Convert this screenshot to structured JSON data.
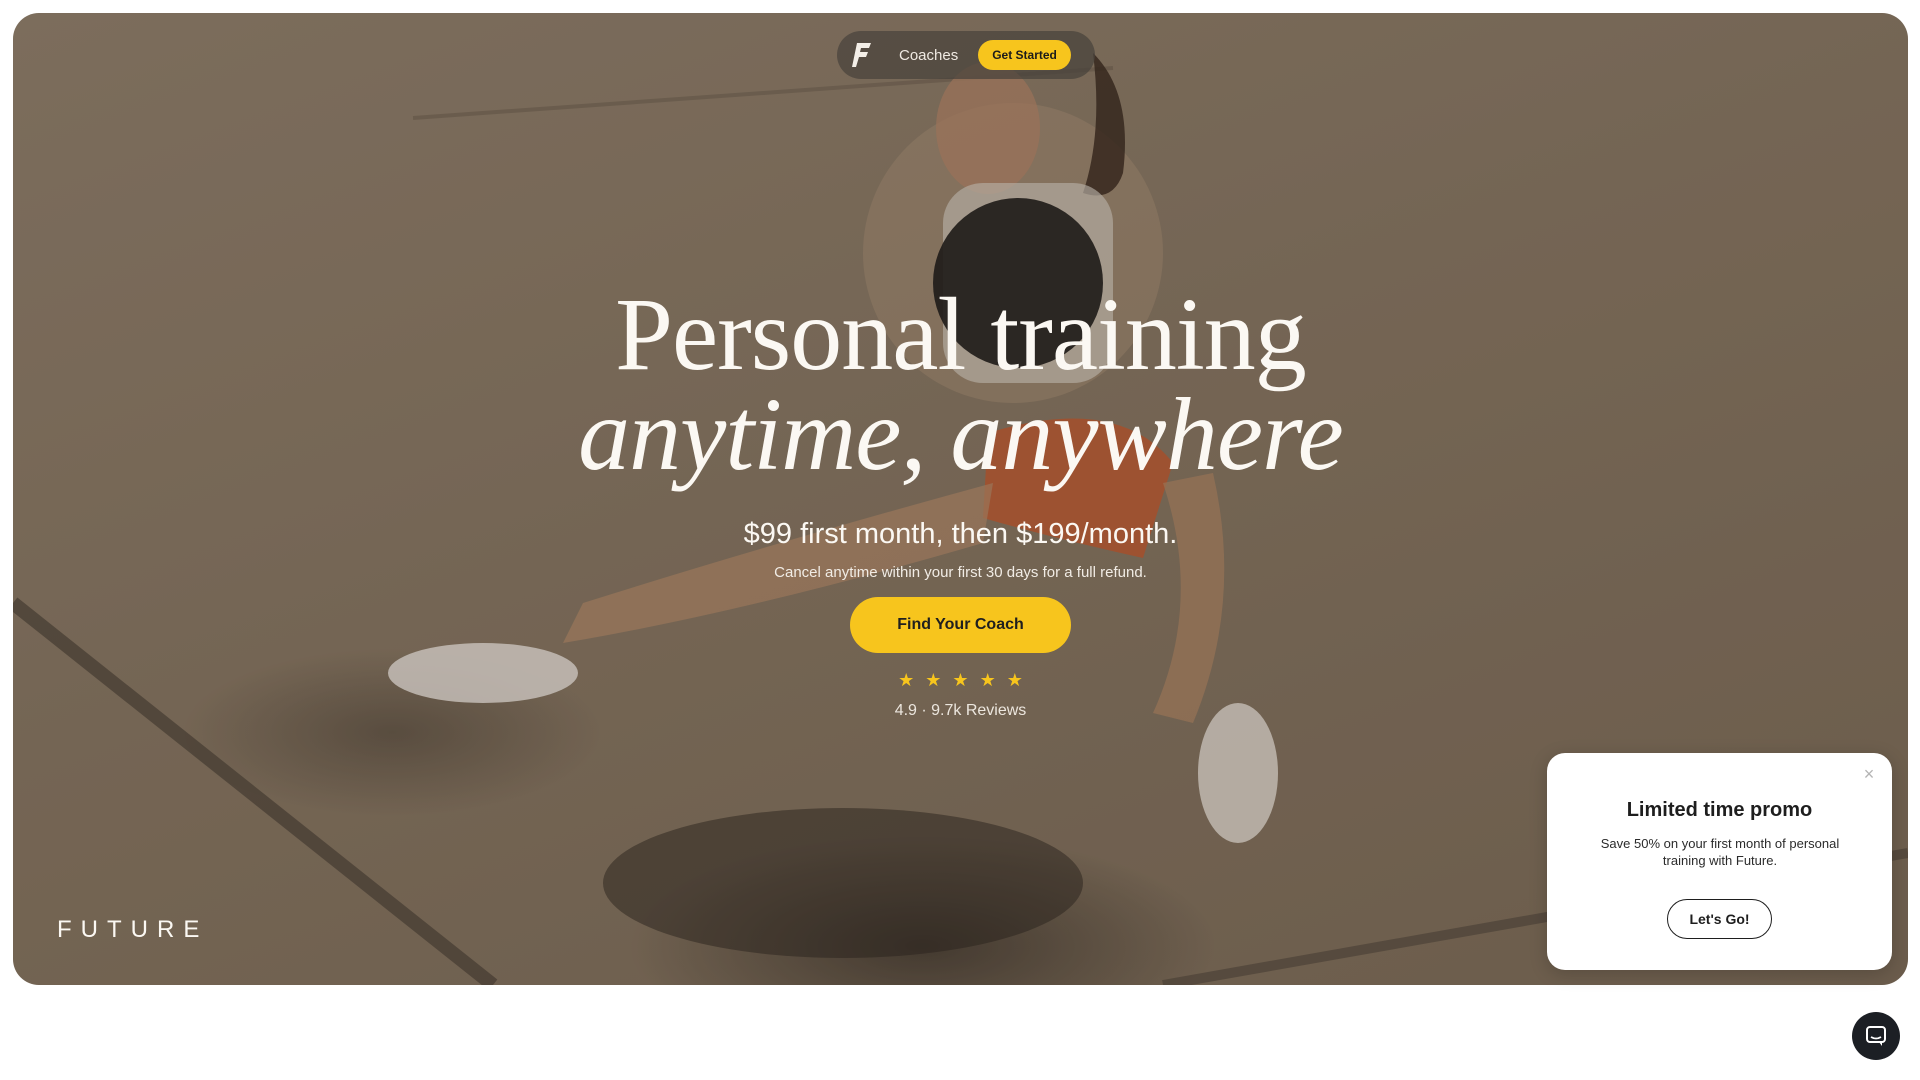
{
  "nav": {
    "coaches_label": "Coaches",
    "cta_label": "Get Started",
    "logo_icon": "future-logo-icon"
  },
  "hero": {
    "headline_line1": "Personal training",
    "headline_line2": "anytime, anywhere",
    "price": "$99 first month, then $199/month.",
    "refund": "Cancel anytime within your first 30 days for a full refund.",
    "cta_label": "Find Your Coach",
    "stars": [
      "★",
      "★",
      "★",
      "★",
      "★"
    ],
    "rating_text": "4.9 · 9.7k Reviews",
    "brand": "FUTURE"
  },
  "promo": {
    "title": "Limited time promo",
    "text": "Save 50% on your first month of personal training with Future.",
    "button_label": "Let's Go!",
    "close_icon": "×"
  },
  "chat": {
    "icon": "chat-icon"
  },
  "colors": {
    "accent": "#f7c51d",
    "hero_text": "#fbf8f3",
    "chat_bg": "#1c1f24"
  }
}
